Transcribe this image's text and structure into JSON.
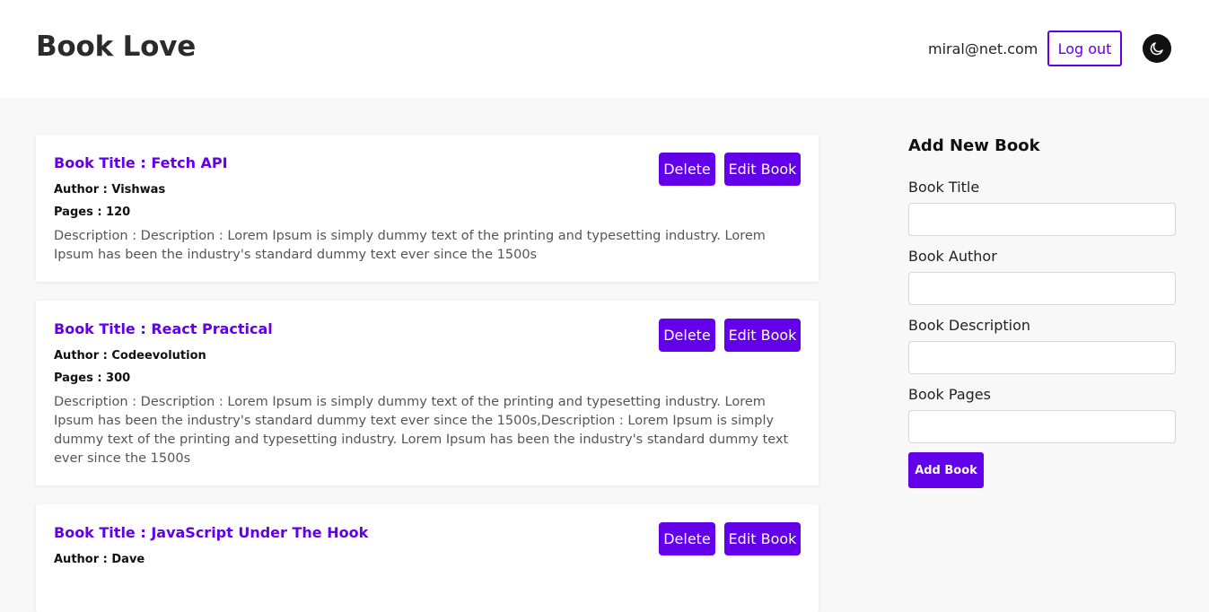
{
  "header": {
    "brand": "Book Love",
    "user_email": "miral@net.com",
    "logout_label": "Log out",
    "theme_icon": "moon-icon"
  },
  "books": [
    {
      "title": "Book Title : Fetch API",
      "author": "Author : Vishwas",
      "pages": "Pages : 120",
      "description": "Description : Description : Lorem Ipsum is simply dummy text of the printing and typesetting industry. Lorem Ipsum has been the industry's standard dummy text ever since the 1500s",
      "delete_label": "Delete",
      "edit_label": "Edit Book"
    },
    {
      "title": "Book Title : React Practical",
      "author": "Author : Codeevolution",
      "pages": "Pages : 300",
      "description": "Description : Description : Lorem Ipsum is simply dummy text of the printing and typesetting industry. Lorem Ipsum has been the industry's standard dummy text ever since the 1500s,Description : Lorem Ipsum is simply dummy text of the printing and typesetting industry. Lorem Ipsum has been the industry's standard dummy text ever since the 1500s",
      "delete_label": "Delete",
      "edit_label": "Edit Book"
    },
    {
      "title": "Book Title : JavaScript Under The Hook",
      "author": "Author : Dave",
      "delete_label": "Delete",
      "edit_label": "Edit Book"
    }
  ],
  "form": {
    "heading": "Add New Book",
    "title_label": "Book Title",
    "title_value": "",
    "author_label": "Book Author",
    "author_value": "",
    "description_label": "Book Description",
    "description_value": "",
    "pages_label": "Book Pages",
    "pages_value": "",
    "submit_label": "Add Book"
  },
  "colors": {
    "accent": "#6200ea",
    "background": "#f8f8f8",
    "card": "#ffffff"
  }
}
